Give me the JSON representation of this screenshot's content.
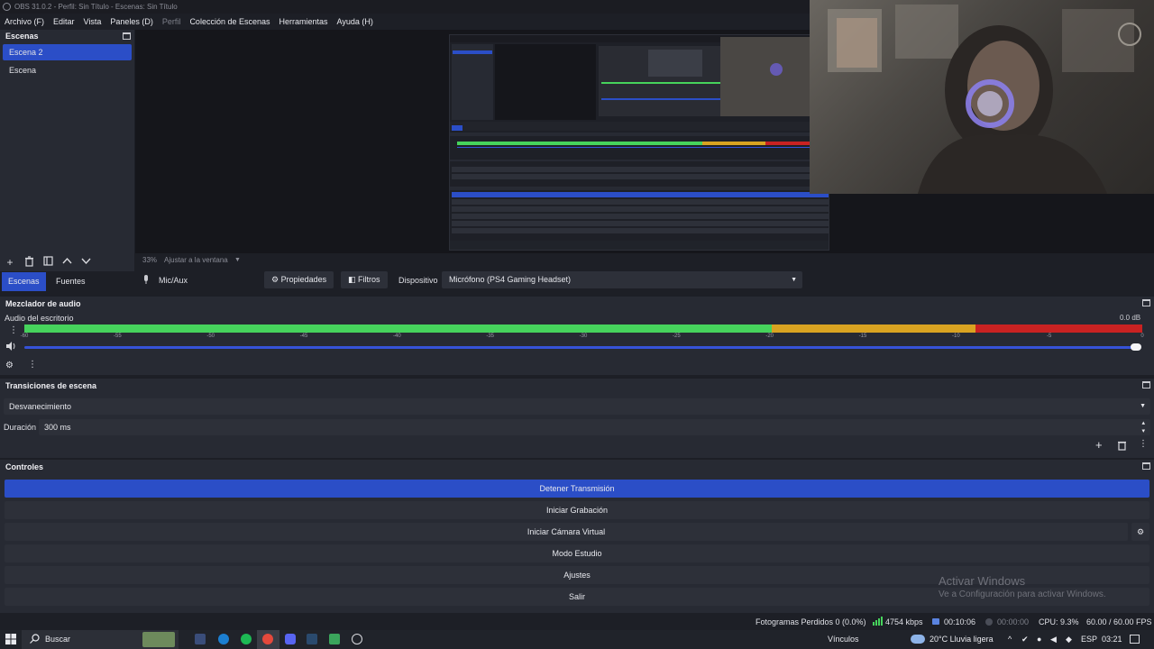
{
  "window": {
    "title": "OBS 31.0.2 - Perfil: Sin Título - Escenas: Sin Título",
    "controls": [
      "–",
      "▫",
      "✕"
    ]
  },
  "menu": {
    "items": [
      "Archivo (F)",
      "Editar",
      "Vista",
      "Paneles (D)",
      "Perfil",
      "Colección de Escenas",
      "Herramientas",
      "Ayuda (H)"
    ]
  },
  "scenes_dock": {
    "title": "Escenas",
    "items": [
      "Escena 2",
      "Escena"
    ],
    "selected_index": 0
  },
  "preview": {
    "zoom_label": "33%",
    "fit_label": "Ajustar a la ventana"
  },
  "context_bar": {
    "source_name": "Mic/Aux",
    "properties_label": "Propiedades",
    "filters_label": "Filtros",
    "device_label": "Dispositivo",
    "device_value": "Micrófono (PS4 Gaming Headset)"
  },
  "dock_tabs": {
    "scenes": "Escenas",
    "sources": "Fuentes",
    "active": "scenes"
  },
  "audio_mixer": {
    "title": "Mezclador de audio",
    "channel_name": "Audio del escritorio",
    "level_text": "0.0 dB",
    "tick_labels": [
      "-60",
      "-55",
      "-50",
      "-45",
      "-40",
      "-35",
      "-30",
      "-25",
      "-20",
      "-15",
      "-10",
      "-5",
      "0"
    ],
    "volume_fraction": 1.0
  },
  "transitions": {
    "title": "Transiciones de escena",
    "selected": "Desvanecimiento",
    "duration_label": "Duración",
    "duration_value": "300 ms"
  },
  "controls": {
    "title": "Controles",
    "stop_stream": "Detener Transmisión",
    "start_recording": "Iniciar Grabación",
    "start_virtual_cam": "Iniciar Cámara Virtual",
    "studio_mode": "Modo Estudio",
    "settings": "Ajustes",
    "exit": "Salir"
  },
  "activation": {
    "line1": "Activar Windows",
    "line2": "Ve a Configuración para activar Windows."
  },
  "status_bar": {
    "dropped_frames": "Fotogramas Perdidos 0 (0.0%)",
    "bitrate": "4754 kbps",
    "stream_time": "00:10:06",
    "record_time": "00:00:00",
    "cpu": "CPU: 9.3%",
    "fps": "60.00 / 60.00 FPS"
  },
  "taskbar": {
    "search_placeholder": "Buscar",
    "links_label": "Vínculos",
    "weather": "20°C  Lluvia ligera",
    "language": "ESP",
    "time": "03:21"
  },
  "colors": {
    "accent": "#2b4ec7",
    "panel": "#272a33",
    "meter_green": "#46d35c",
    "meter_yellow": "#d9a321",
    "meter_red": "#c92222"
  }
}
